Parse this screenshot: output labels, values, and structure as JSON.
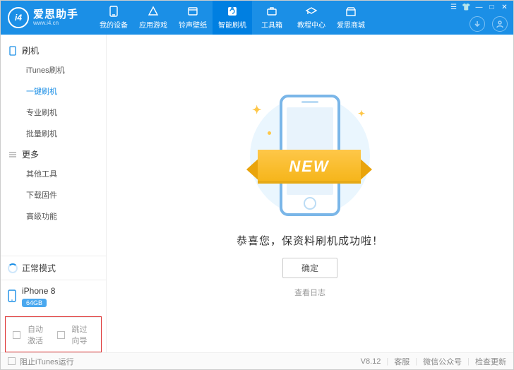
{
  "brand": {
    "name": "爱思助手",
    "site": "www.i4.cn",
    "logo": "i4"
  },
  "nav": {
    "device": "我的设备",
    "apps": "应用游戏",
    "ring": "铃声壁纸",
    "flash": "智能刷机",
    "tools": "工具箱",
    "tutor": "教程中心",
    "mall": "爱思商城"
  },
  "sidebar": {
    "flash_header": "刷机",
    "items_flash": {
      "itunes": "iTunes刷机",
      "onekey": "一键刷机",
      "pro": "专业刷机",
      "batch": "批量刷机"
    },
    "more_header": "更多",
    "items_more": {
      "other": "其他工具",
      "download": "下载固件",
      "adv": "高级功能"
    },
    "mode": "正常模式",
    "device_name": "iPhone 8",
    "storage": "64GB",
    "auto_activate": "自动激活",
    "skip_guide": "跳过向导"
  },
  "content": {
    "ribbon": "NEW",
    "success": "恭喜您，保资料刷机成功啦！",
    "ok_btn": "确定",
    "log_link": "查看日志"
  },
  "status": {
    "stop_itunes": "阻止iTunes运行",
    "version": "V8.12",
    "support": "客服",
    "wechat": "微信公众号",
    "update": "检查更新"
  }
}
